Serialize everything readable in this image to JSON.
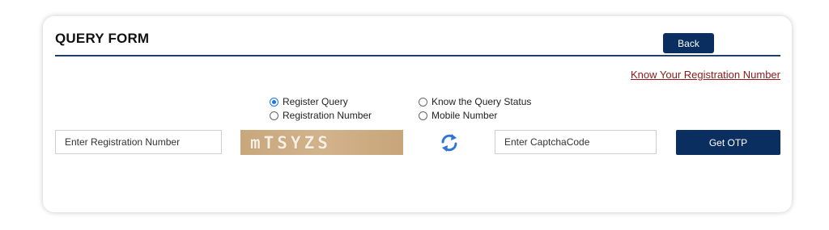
{
  "form": {
    "title": "QUERY FORM",
    "back_label": "Back",
    "know_link": "Know Your Registration Number"
  },
  "query_type": {
    "options": [
      "Register Query",
      "Know the Query Status"
    ],
    "selected": "Register Query"
  },
  "search_by": {
    "options": [
      "Registration Number",
      "Mobile Number"
    ],
    "selected": ""
  },
  "fields": {
    "registration_placeholder": "Enter Registration Number",
    "captcha_placeholder": "Enter CaptchaCode"
  },
  "captcha": {
    "text": "mTSYZS"
  },
  "buttons": {
    "otp_label": "Get OTP"
  },
  "icons": {
    "refresh": "refresh-icon"
  },
  "colors": {
    "primary": "#0b2e61",
    "link": "#8b1a1a",
    "radio_checked": "#1a73e8"
  }
}
